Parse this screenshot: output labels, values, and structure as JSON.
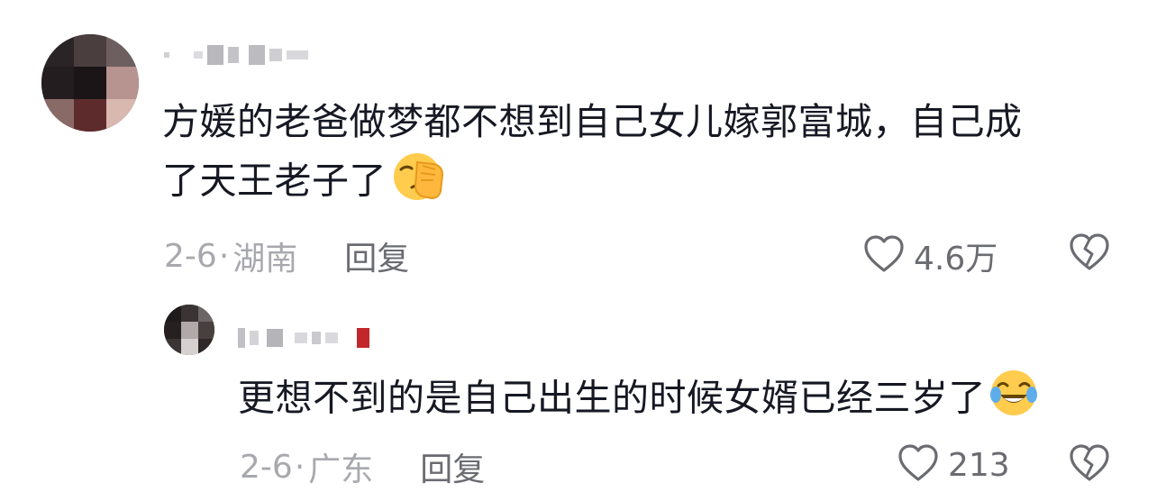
{
  "comments": [
    {
      "username": "",
      "text_line1": "方媛的老爸做梦都不想到自己女儿嫁郭富城，自己成",
      "text_line2": "了天王老子了",
      "emoji": "facepalm-emoji",
      "date": "2-6",
      "separator": "·",
      "location": "湖南",
      "reply_label": "回复",
      "likes": "4.6万"
    },
    {
      "username": "",
      "text": "更想不到的是自己出生的时候女婿已经三岁了",
      "emoji": "crying-laughing-emoji",
      "date": "2-6",
      "separator": "·",
      "location": "广东",
      "reply_label": "回复",
      "likes": "213"
    }
  ],
  "icons": {
    "like": "heart-outline-icon",
    "dislike": "broken-heart-icon"
  },
  "colors": {
    "text": "#161823",
    "meta": "#a8a9ae",
    "action": "#6b6c72"
  }
}
